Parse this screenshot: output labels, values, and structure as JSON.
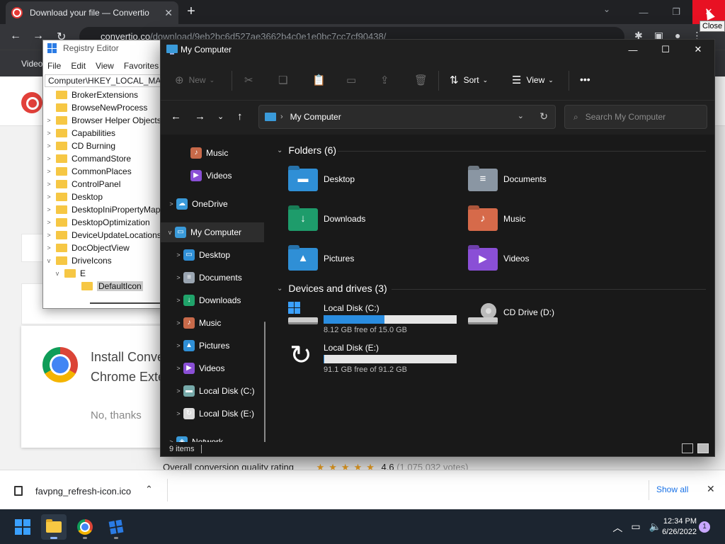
{
  "browser": {
    "tab_title": "Download your file — Convertio",
    "url_domain": "convertio.co",
    "url_path": "/download/9eb2bc6d527ae3662b4c0e1e0bc7cc7cf90438/",
    "bookmark_label": "Video",
    "tooltip": "Close"
  },
  "page": {
    "ext_title": "Install Convertio\nChrome Extension",
    "no_thanks": "No, thanks",
    "rating_label": "Overall conversion quality rating",
    "rating_stars": "★★★★★",
    "rating_value": "4.6",
    "rating_votes": "(1,075,032 votes)"
  },
  "download_bar": {
    "file_name": "favpng_refresh-icon.ico",
    "show_all": "Show all"
  },
  "taskbar": {
    "time": "12:34 PM",
    "date": "6/26/2022",
    "notification_count": "1"
  },
  "regedit": {
    "title": "Registry Editor",
    "menu": [
      "File",
      "Edit",
      "View",
      "Favorites"
    ],
    "path": "Computer\\HKEY_LOCAL_MACHINE\\SOFTWARE\\Microsoft\\Windows\\CurrentVersion\\Explorer\\DriveIcons\\E\\DefaultIcon",
    "tree": [
      {
        "label": "BrokerExtensions",
        "expander": ""
      },
      {
        "label": "BrowseNewProcess",
        "expander": ""
      },
      {
        "label": "Browser Helper Objects",
        "expander": ">"
      },
      {
        "label": "Capabilities",
        "expander": ">"
      },
      {
        "label": "CD Burning",
        "expander": ">"
      },
      {
        "label": "CommandStore",
        "expander": ">"
      },
      {
        "label": "CommonPlaces",
        "expander": ">"
      },
      {
        "label": "ControlPanel",
        "expander": ">"
      },
      {
        "label": "Desktop",
        "expander": ">"
      },
      {
        "label": "DesktopIniPropertyMap",
        "expander": ">"
      },
      {
        "label": "DesktopOptimization",
        "expander": ">"
      },
      {
        "label": "DeviceUpdateLocations",
        "expander": ">"
      },
      {
        "label": "DocObjectView",
        "expander": ">"
      },
      {
        "label": "DriveIcons",
        "expander": "v"
      },
      {
        "label": "E",
        "expander": "v"
      },
      {
        "label": "DefaultIcon",
        "expander": ""
      }
    ]
  },
  "explorer": {
    "title": "My Computer",
    "commands": {
      "new": "New",
      "sort": "Sort",
      "view": "View",
      "more": "•••"
    },
    "address": "My Computer",
    "search_placeholder": "Search My Computer",
    "nav": [
      {
        "label": "Music",
        "chevron": "",
        "color": "#c86a4a",
        "glyph": "♪"
      },
      {
        "label": "Videos",
        "chevron": "",
        "color": "#8a4fd6",
        "glyph": "▶"
      },
      {
        "label": "OneDrive",
        "chevron": ">",
        "color": "#3a9ad9",
        "glyph": "☁"
      },
      {
        "label": "My Computer",
        "chevron": "v",
        "color": "#3a9ad9",
        "glyph": "▭"
      },
      {
        "label": "Desktop",
        "chevron": ">",
        "color": "#2f8fd6",
        "glyph": "▭"
      },
      {
        "label": "Documents",
        "chevron": ">",
        "color": "#9aa5b1",
        "glyph": "≡"
      },
      {
        "label": "Downloads",
        "chevron": ">",
        "color": "#20a36a",
        "glyph": "↓"
      },
      {
        "label": "Music",
        "chevron": ">",
        "color": "#c86a4a",
        "glyph": "♪"
      },
      {
        "label": "Pictures",
        "chevron": ">",
        "color": "#2f8fd6",
        "glyph": "▲"
      },
      {
        "label": "Videos",
        "chevron": ">",
        "color": "#8a4fd6",
        "glyph": "▶"
      },
      {
        "label": "Local Disk (C:)",
        "chevron": ">",
        "color": "#7aa",
        "glyph": "▬"
      },
      {
        "label": "Local Disk (E:)",
        "chevron": ">",
        "color": "#ddd",
        "glyph": "↻"
      },
      {
        "label": "Network",
        "chevron": ">",
        "color": "#3a9ad9",
        "glyph": "◈"
      }
    ],
    "folders_header": "Folders (6)",
    "folders": [
      {
        "label": "Desktop",
        "color": "#2f8fd6",
        "glyph": "▬"
      },
      {
        "label": "Documents",
        "color": "#8a96a3",
        "glyph": "≡"
      },
      {
        "label": "Downloads",
        "color": "#1e9c6b",
        "glyph": "↓"
      },
      {
        "label": "Music",
        "color": "#d66a4a",
        "glyph": "♪"
      },
      {
        "label": "Pictures",
        "color": "#2f8fd6",
        "glyph": "▲"
      },
      {
        "label": "Videos",
        "color": "#8a4fd6",
        "glyph": "▶"
      }
    ],
    "drives_header": "Devices and drives (3)",
    "drives": [
      {
        "label": "Local Disk (C:)",
        "free": "8.12 GB free of 15.0 GB",
        "used_fraction": 0.459,
        "kind": "windows-disk"
      },
      {
        "label": "CD Drive (D:)",
        "free": "",
        "used_fraction": null,
        "kind": "cd-drive"
      },
      {
        "label": "Local Disk (E:)",
        "free": "91.1 GB free of 91.2 GB",
        "used_fraction": 0.001,
        "kind": "refresh-disk"
      }
    ],
    "status_items": "9 items"
  }
}
